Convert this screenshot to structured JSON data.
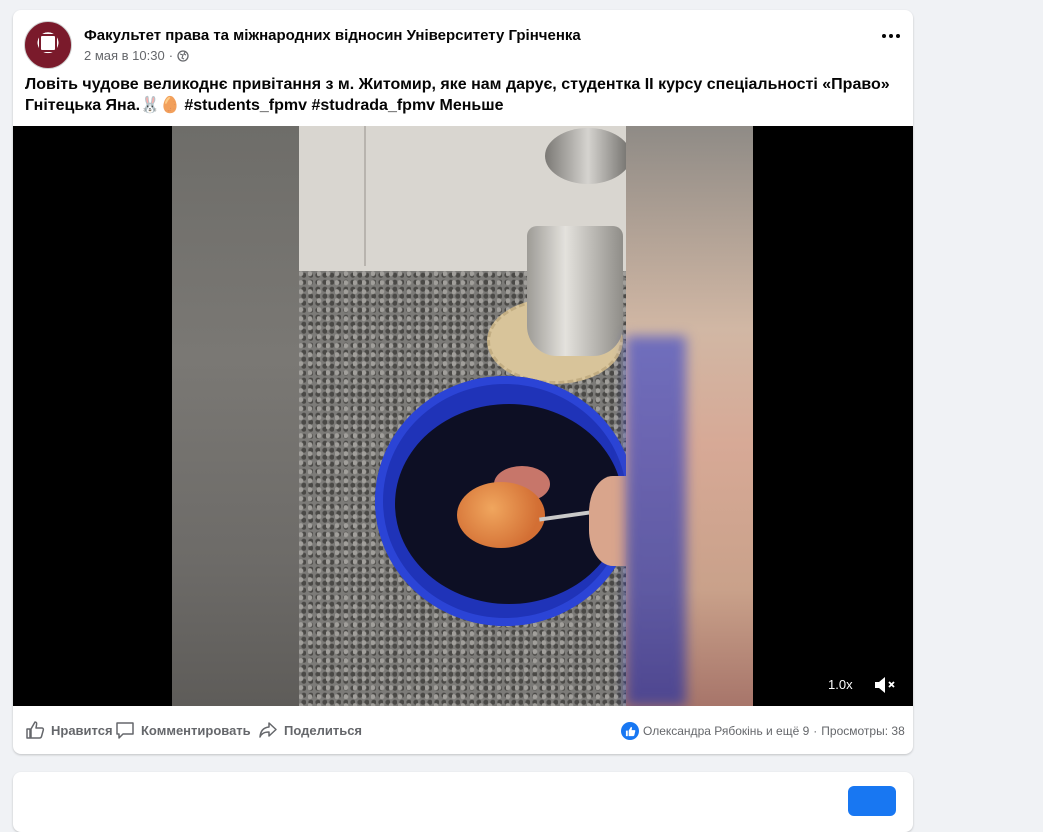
{
  "post": {
    "page_name": "Факультет права та міжнародних відносин Університету Грінченка",
    "date": "2 мая в 10:30",
    "separator": "·",
    "text": "Ловіть чудове великоднє привітання з м. Житомир, яке нам дарує, студентка II курсу спеціальності «Право» Гнітецька Яна.🐰🥚 #students_fpmv #studrada_fpmv Меньше"
  },
  "video": {
    "speed": "1.0x"
  },
  "actions": {
    "like": "Нравится",
    "comment": "Комментировать",
    "share": "Поделиться"
  },
  "reactions": {
    "people": "Олександра Рябокінь и ещё 9",
    "separator": "·",
    "views": "Просмотры: 38"
  },
  "colors": {
    "accent": "#1877f2",
    "secondary_text": "#65676b",
    "background": "#f0f2f5"
  },
  "icons": [
    "globe-icon",
    "more-icon",
    "like-icon",
    "comment-icon",
    "share-icon",
    "mute-icon",
    "like-reaction-icon"
  ]
}
